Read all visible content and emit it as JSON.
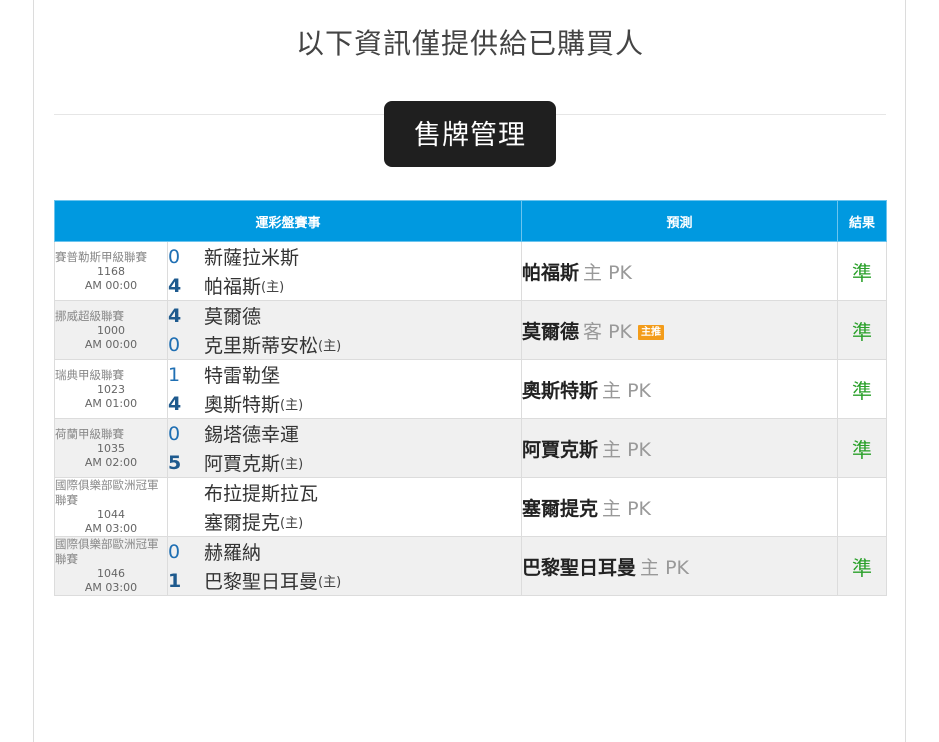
{
  "page": {
    "notice": "以下資訊僅提供給已購買人",
    "section_tag": "售牌管理"
  },
  "table": {
    "headers": {
      "game": "運彩盤賽事",
      "prediction": "預測",
      "result": "結果"
    },
    "rows": [
      {
        "league": "賽普勒斯甲級聯賽",
        "code": "1168",
        "time": "AM 00:00",
        "away_score": "0",
        "home_score": "4",
        "away_team": "新薩拉米斯",
        "home_team": "帕福斯",
        "home_mark": "(主)",
        "pick_team": "帕福斯",
        "pick_side": "主 PK",
        "badge": "",
        "result": "準"
      },
      {
        "league": "挪威超級聯賽",
        "code": "1000",
        "time": "AM 00:00",
        "away_score": "4",
        "home_score": "0",
        "away_team": "莫爾德",
        "home_team": "克里斯蒂安松",
        "home_mark": "(主)",
        "pick_team": "莫爾德",
        "pick_side": "客 PK",
        "badge": "主推",
        "result": "準"
      },
      {
        "league": "瑞典甲級聯賽",
        "code": "1023",
        "time": "AM 01:00",
        "away_score": "1",
        "home_score": "4",
        "away_team": "特雷勒堡",
        "home_team": "奧斯特斯",
        "home_mark": "(主)",
        "pick_team": "奧斯特斯",
        "pick_side": "主 PK",
        "badge": "",
        "result": "準"
      },
      {
        "league": "荷蘭甲級聯賽",
        "code": "1035",
        "time": "AM 02:00",
        "away_score": "0",
        "home_score": "5",
        "away_team": "錫塔德幸運",
        "home_team": "阿賈克斯",
        "home_mark": "(主)",
        "pick_team": "阿賈克斯",
        "pick_side": "主 PK",
        "badge": "",
        "result": "準"
      },
      {
        "league": "國際俱樂部歐洲冠軍聯賽",
        "code": "1044",
        "time": "AM 03:00",
        "away_score": "",
        "home_score": "",
        "away_team": "布拉提斯拉瓦",
        "home_team": "塞爾提克",
        "home_mark": "(主)",
        "pick_team": "塞爾提克",
        "pick_side": "主 PK",
        "badge": "",
        "result": ""
      },
      {
        "league": "國際俱樂部歐洲冠軍聯賽",
        "code": "1046",
        "time": "AM 03:00",
        "away_score": "0",
        "home_score": "1",
        "away_team": "赫羅納",
        "home_team": "巴黎聖日耳曼",
        "home_mark": "(主)",
        "pick_team": "巴黎聖日耳曼",
        "pick_side": "主 PK",
        "badge": "",
        "result": "準"
      }
    ]
  }
}
